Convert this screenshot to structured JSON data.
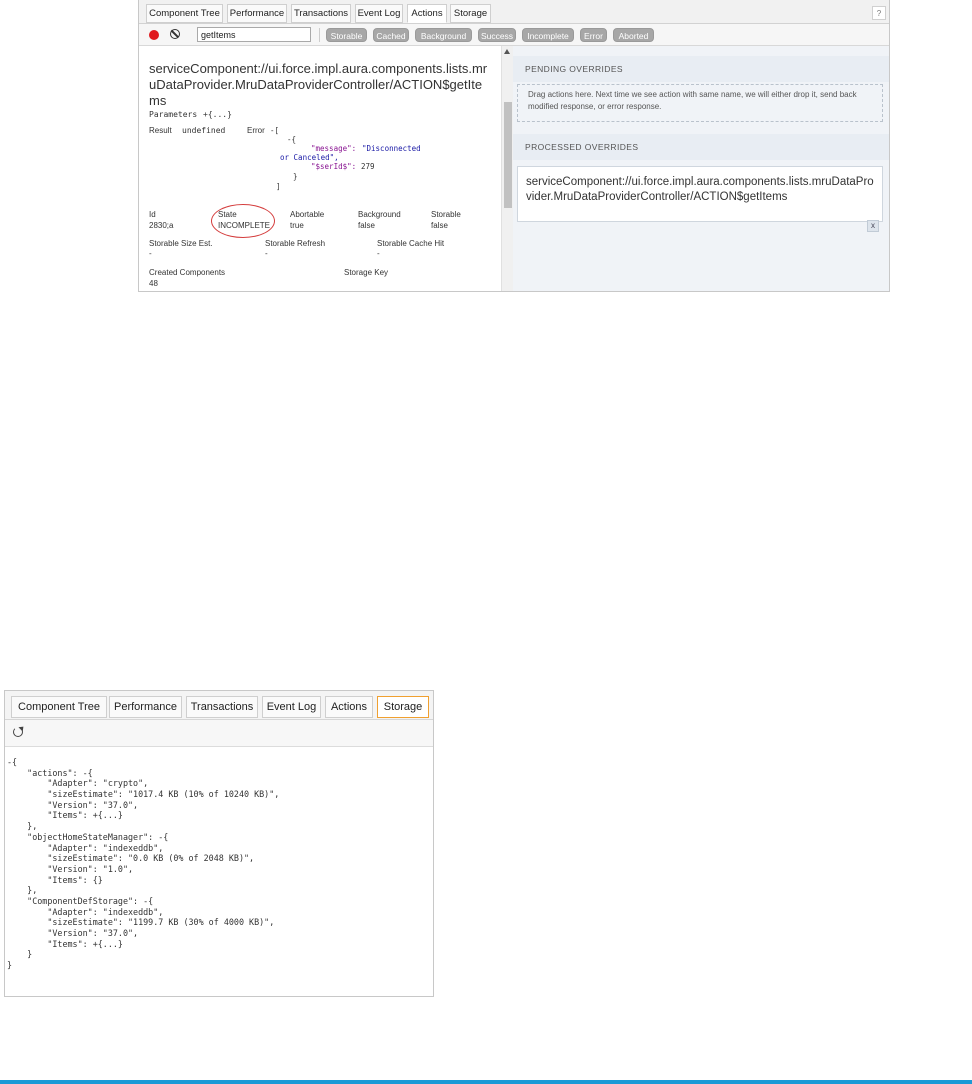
{
  "actions_panel": {
    "tabs": [
      "Component Tree",
      "Performance",
      "Transactions",
      "Event Log",
      "Actions",
      "Storage"
    ],
    "active_tab": "Actions",
    "help_label": "?",
    "filter_value": "getItems",
    "filter_buttons": [
      "Storable",
      "Cached",
      "Background",
      "Success",
      "Incomplete",
      "Error",
      "Aborted"
    ],
    "action_name": "serviceComponent://ui.force.impl.aura.components.lists.mruDataProvider.MruDataProviderController/ACTION$getItems",
    "parameters_label": "Parameters",
    "parameters_value": "+{...}",
    "result_label": "Result",
    "result_value": "undefined",
    "error_label": "Error",
    "error_open": "-[",
    "error_obj_open": "-{",
    "error_message_key": "\"message\":",
    "error_message_value_1": "\"Disconnected",
    "error_message_value_2": "or Canceled\",",
    "error_id_key": "\"$serId$\":",
    "error_id_value": "279",
    "error_obj_close": "}",
    "error_close": "]",
    "fields": {
      "id_label": "Id",
      "id_value": "2830;a",
      "state_label": "State",
      "state_value": "INCOMPLETE",
      "abortable_label": "Abortable",
      "abortable_value": "true",
      "background_label": "Background",
      "background_value": "false",
      "storable_label": "Storable",
      "storable_value": "false",
      "size_label": "Storable Size Est.",
      "size_value": "-",
      "refresh_label": "Storable Refresh",
      "refresh_value": "-",
      "cachehit_label": "Storable Cache Hit",
      "cachehit_value": "-",
      "created_label": "Created Components",
      "created_value": "48",
      "storagekey_label": "Storage Key"
    },
    "pending_overrides_title": "PENDING OVERRIDES",
    "pending_overrides_hint": "Drag actions here. Next time we see action with same name, we will either drop it, send back modified response, or error response.",
    "processed_overrides_title": "PROCESSED OVERRIDES",
    "processed_item": "serviceComponent://ui.force.impl.aura.components.lists.mruDataProvider.MruDataProviderController/ACTION$getItems",
    "remove_label": "x"
  },
  "storage_panel": {
    "tabs": [
      "Component Tree",
      "Performance",
      "Transactions",
      "Event Log",
      "Actions",
      "Storage"
    ],
    "active_tab": "Storage",
    "tree_lines": [
      "-{",
      "    \"actions\": -{",
      "        \"Adapter\": \"crypto\",",
      "        \"sizeEstimate\": \"1017.4 KB (10% of 10240 KB)\",",
      "        \"Version\": \"37.0\",",
      "        \"Items\": +{...}",
      "    },",
      "    \"objectHomeStateManager\": -{",
      "        \"Adapter\": \"indexeddb\",",
      "        \"sizeEstimate\": \"0.0 KB (0% of 2048 KB)\",",
      "        \"Version\": \"1.0\",",
      "        \"Items\": {}",
      "    },",
      "    \"ComponentDefStorage\": -{",
      "        \"Adapter\": \"indexeddb\",",
      "        \"sizeEstimate\": \"1199.7 KB (30% of 4000 KB)\",",
      "        \"Version\": \"37.0\",",
      "        \"Items\": +{...}",
      "    }",
      "}"
    ]
  },
  "colors": {
    "record": "#e0191d",
    "filter_button": "#a7a7a7",
    "state_highlight": "#d43d3d",
    "active_storage_tab": "#f0a030",
    "bottom_rule": "#1b9ad6"
  }
}
